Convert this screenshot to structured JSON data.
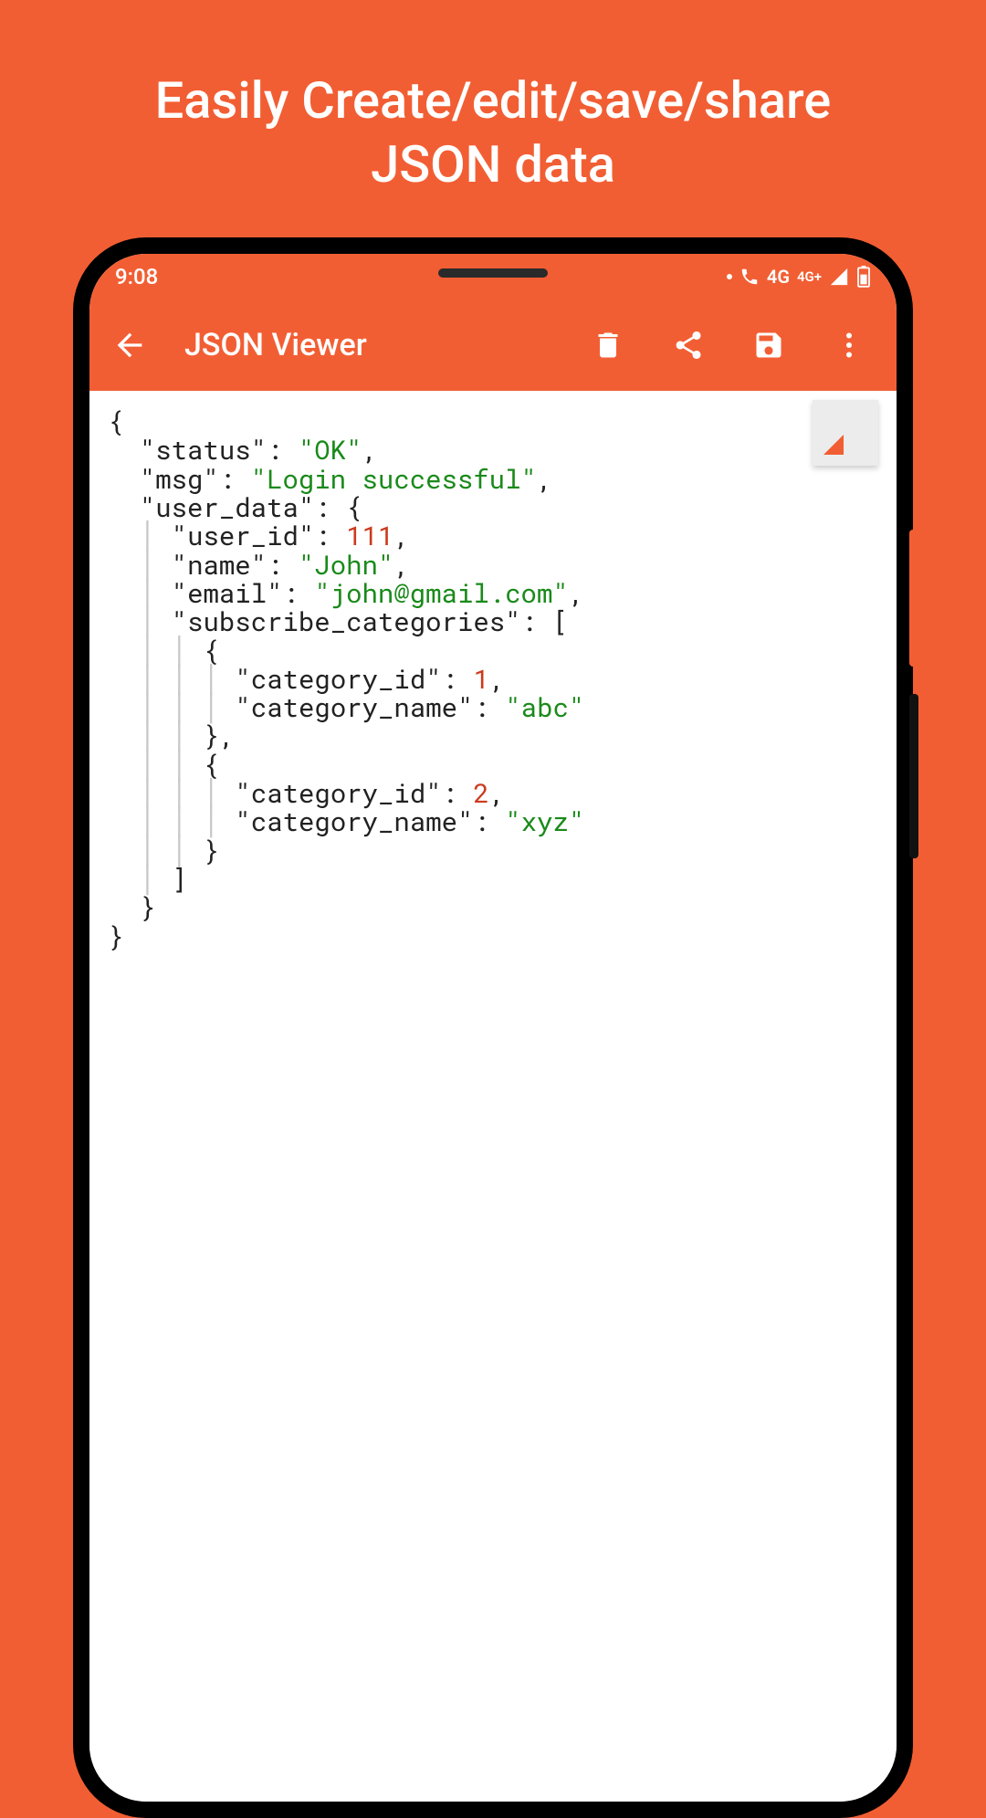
{
  "promo": {
    "line1": "Easily Create/edit/save/share",
    "line2": "JSON data"
  },
  "status": {
    "time": "9:08",
    "network_label": "4G",
    "network_label2": "4G+"
  },
  "appbar": {
    "title": "JSON Viewer"
  },
  "json": {
    "status_key": "\"status\"",
    "status_val": "\"OK\"",
    "msg_key": "\"msg\"",
    "msg_val": "\"Login successful\"",
    "userdata_key": "\"user_data\"",
    "userid_key": "\"user_id\"",
    "userid_val": "111",
    "name_key": "\"name\"",
    "name_val": "\"John\"",
    "email_key": "\"email\"",
    "email_val": "\"john@gmail.com\"",
    "subcat_key": "\"subscribe_categories\"",
    "catid_key": "\"category_id\"",
    "catname_key": "\"category_name\"",
    "cat1_id": "1",
    "cat1_name": "\"abc\"",
    "cat2_id": "2",
    "cat2_name": "\"xyz\""
  }
}
